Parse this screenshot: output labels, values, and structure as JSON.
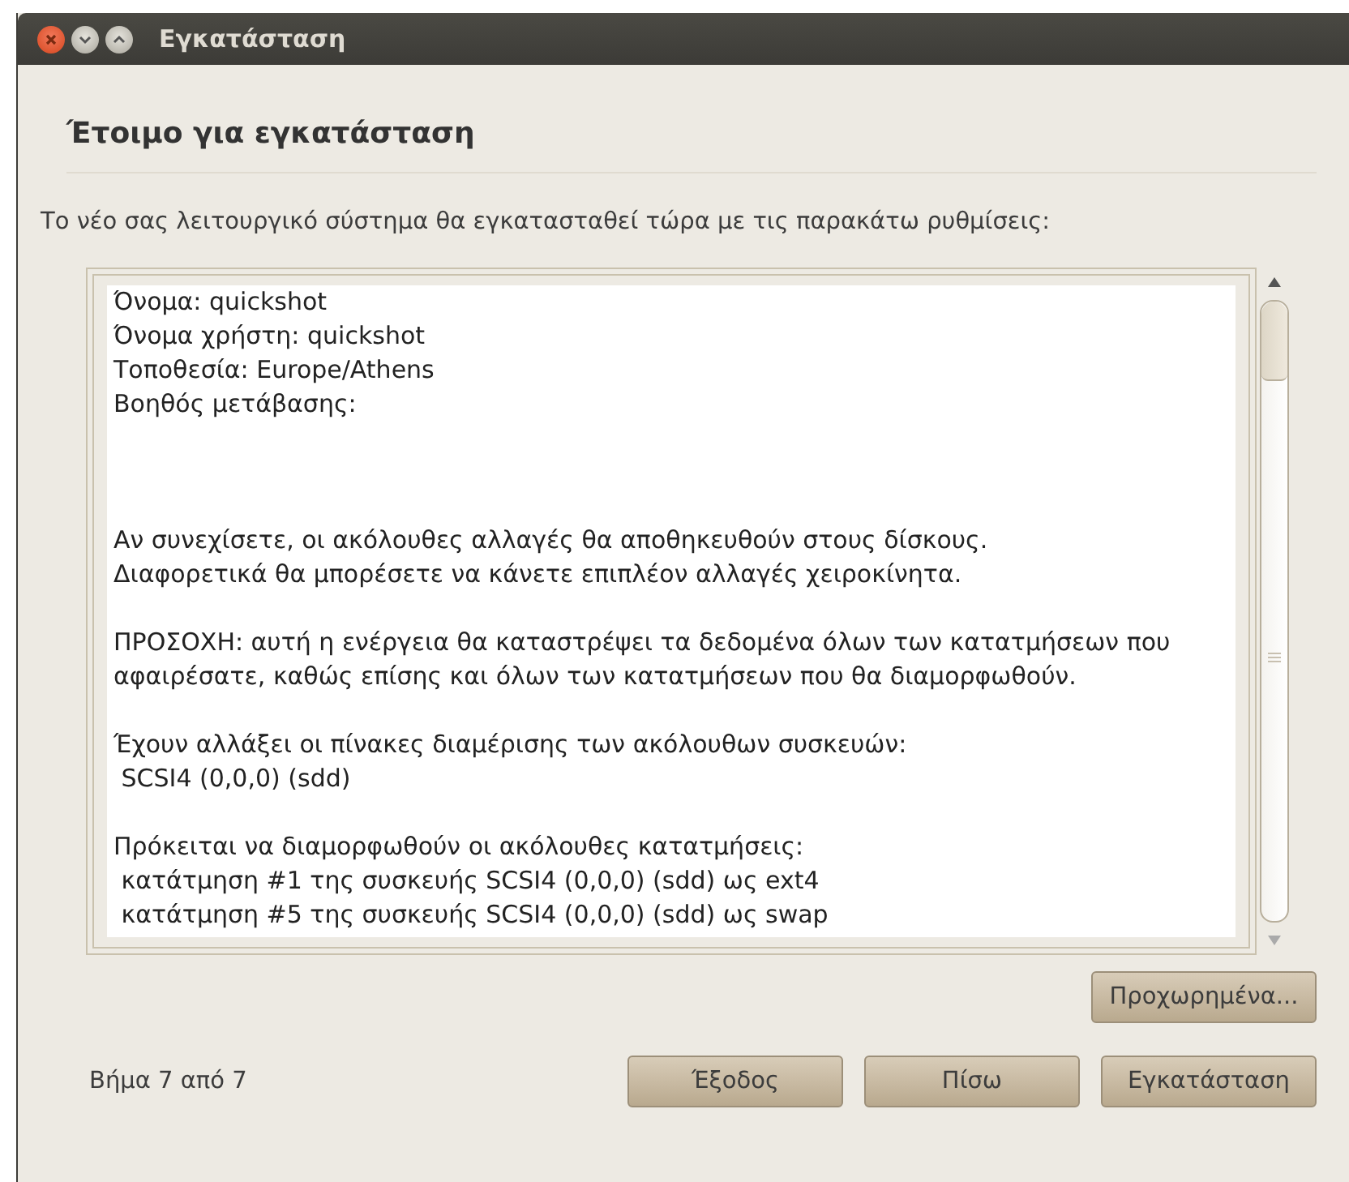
{
  "window": {
    "title": "Εγκατάσταση"
  },
  "heading": "Έτοιμο για εγκατάσταση",
  "description": "Το νέο σας λειτουργικό σύστημα θα εγκατασταθεί τώρα με τις παρακάτω ρυθμίσεις:",
  "summary": [
    [
      "Όνομα: quickshot",
      "Όνομα χρήστη: quickshot",
      "Τοποθεσία: Europe/Athens",
      "Βοηθός μετάβασης:"
    ],
    [
      "Αν συνεχίσετε, οι ακόλουθες αλλαγές θα αποθηκευθούν στους δίσκους.",
      "Διαφορετικά θα μπορέσετε να κάνετε επιπλέον αλλαγές χειροκίνητα."
    ],
    [
      "ΠΡΟΣΟΧΗ: αυτή η ενέργεια θα καταστρέψει τα δεδομένα όλων των κατατμήσεων που",
      "αφαιρέσατε, καθώς επίσης και όλων των κατατμήσεων που θα διαμορφωθούν."
    ],
    [
      "Έχουν αλλάξει οι πίνακες διαμέρισης των ακόλουθων συσκευών:",
      " SCSI4 (0,0,0) (sdd)"
    ],
    [
      "Πρόκειται να διαμορφωθούν οι ακόλουθες κατατμήσεις:",
      " κατάτμηση #1 της συσκευής SCSI4 (0,0,0) (sdd) ως ext4",
      " κατάτμηση #5 της συσκευής SCSI4 (0,0,0) (sdd) ως swap"
    ]
  ],
  "advanced_button": "Προχωρημένα...",
  "step": "Βήμα 7 από 7",
  "buttons": [
    "Έξοδος",
    "Πίσω",
    "Εγκατάσταση"
  ]
}
